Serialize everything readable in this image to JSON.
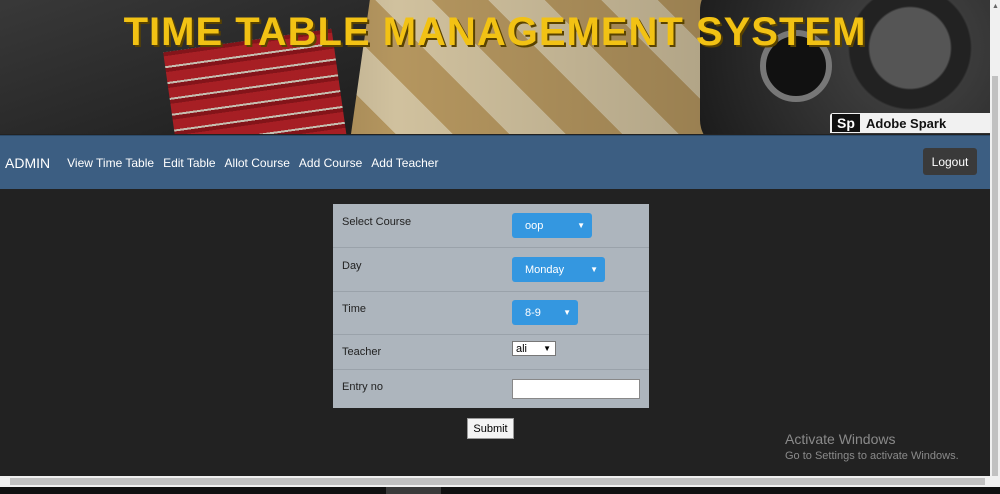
{
  "banner": {
    "title": "TIME TABLE MANAGEMENT SYSTEM",
    "watermark_logo": "Sp",
    "watermark_text": "Adobe Spark"
  },
  "navbar": {
    "brand": "ADMIN",
    "items": [
      "View Time Table",
      "Edit Table",
      "Allot Course",
      "Add Course",
      "Add Teacher"
    ],
    "logout_label": "Logout"
  },
  "form": {
    "course": {
      "label": "Select Course",
      "value": "oop"
    },
    "day": {
      "label": "Day",
      "value": "Monday"
    },
    "time": {
      "label": "Time",
      "value": "8-9"
    },
    "teacher": {
      "label": "Teacher",
      "value": "ali"
    },
    "entry": {
      "label": "Entry no",
      "value": ""
    },
    "submit_label": "Submit"
  },
  "os_notice": {
    "line1": "Activate Windows",
    "line2": "Go to Settings to activate Windows."
  },
  "colors": {
    "navbar": "#3c5e82",
    "title": "#f2c214",
    "select_accent": "#3497e0",
    "background": "#222222"
  }
}
